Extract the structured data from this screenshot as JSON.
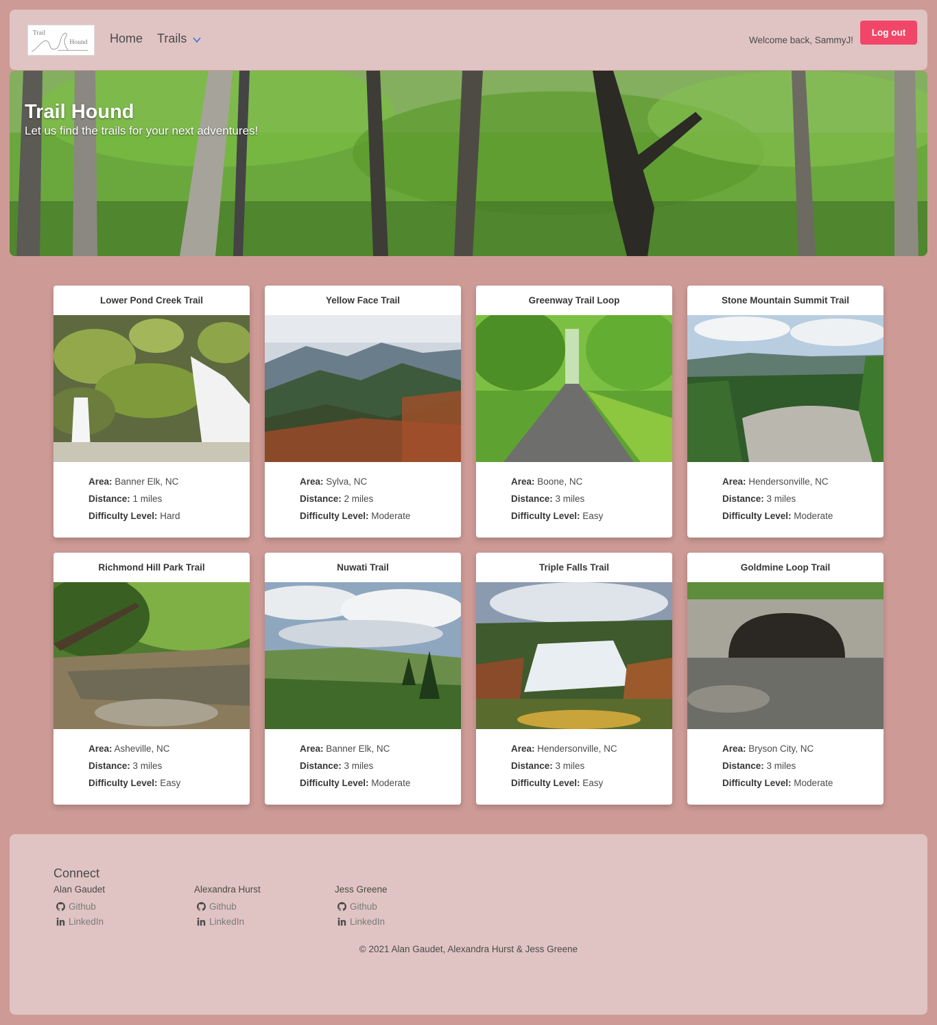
{
  "nav": {
    "logo_text_1": "Trail",
    "logo_text_2": "Hound",
    "home": "Home",
    "trails": "Trails",
    "welcome": "Welcome back, SammyJ!",
    "logout": "Log out"
  },
  "hero": {
    "title": "Trail Hound",
    "subtitle": "Let us find the trails for your next adventures!"
  },
  "labels": {
    "area": "Area:",
    "distance": "Distance:",
    "difficulty": "Difficulty Level:"
  },
  "trails": [
    {
      "name": "Lower Pond Creek Trail",
      "area": "Banner Elk, NC",
      "distance": "1 miles",
      "difficulty": "Hard",
      "scene": "waterfall-rocks"
    },
    {
      "name": "Yellow Face Trail",
      "area": "Sylva, NC",
      "distance": "2 miles",
      "difficulty": "Moderate",
      "scene": "mountain-vista"
    },
    {
      "name": "Greenway Trail Loop",
      "area": "Boone, NC",
      "distance": "3 miles",
      "difficulty": "Easy",
      "scene": "paved-path"
    },
    {
      "name": "Stone Mountain Summit Trail",
      "area": "Hendersonville, NC",
      "distance": "3 miles",
      "difficulty": "Moderate",
      "scene": "summit-rock"
    },
    {
      "name": "Richmond Hill Park Trail",
      "area": "Asheville, NC",
      "distance": "3 miles",
      "difficulty": "Easy",
      "scene": "creek"
    },
    {
      "name": "Nuwati Trail",
      "area": "Banner Elk, NC",
      "distance": "3 miles",
      "difficulty": "Moderate",
      "scene": "cloudy-ridge"
    },
    {
      "name": "Triple Falls Trail",
      "area": "Hendersonville, NC",
      "distance": "3 miles",
      "difficulty": "Easy",
      "scene": "falls"
    },
    {
      "name": "Goldmine Loop Trail",
      "area": "Bryson City, NC",
      "distance": "3 miles",
      "difficulty": "Moderate",
      "scene": "tunnel"
    }
  ],
  "footer": {
    "connect": "Connect",
    "members": [
      {
        "name": "Alan Gaudet",
        "github": "Github",
        "linkedin": "LinkedIn"
      },
      {
        "name": "Alexandra Hurst",
        "github": "Github",
        "linkedin": "LinkedIn"
      },
      {
        "name": "Jess Greene",
        "github": "Github",
        "linkedin": "LinkedIn"
      }
    ],
    "copyright": "© 2021 Alan Gaudet, Alexandra Hurst & Jess Greene"
  },
  "colors": {
    "background": "#cd9a95",
    "panel": "#e0c4c3",
    "logout_button": "#f14668",
    "chevron": "#3e6fd8"
  },
  "icons": {
    "trails_dropdown": "chevron-down-icon",
    "github": "github-icon",
    "linkedin": "linkedin-icon"
  }
}
